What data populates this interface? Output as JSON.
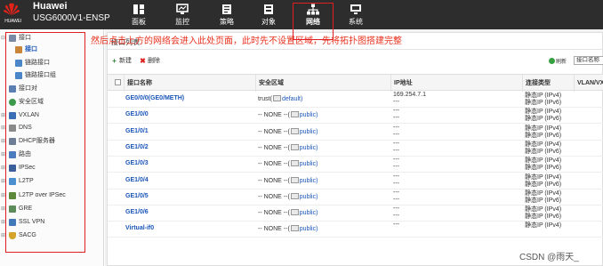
{
  "header": {
    "logo_text": "HUAWEI",
    "brand": "Huawei",
    "model": "USG6000V1-ENSP",
    "nav": [
      {
        "label": "面板",
        "icon": "dashboard-icon"
      },
      {
        "label": "监控",
        "icon": "monitor-icon"
      },
      {
        "label": "策略",
        "icon": "policy-icon"
      },
      {
        "label": "对象",
        "icon": "object-icon"
      },
      {
        "label": "网络",
        "icon": "network-icon",
        "active": true
      },
      {
        "label": "系统",
        "icon": "system-icon"
      }
    ]
  },
  "sidebar": {
    "items": [
      {
        "label": "接口",
        "icon": "interface-folder-icon",
        "expander": "⊟"
      },
      {
        "label": "接口",
        "icon": "interface-icon",
        "selected": true
      },
      {
        "label": "链路接口",
        "icon": "link-interface-icon"
      },
      {
        "label": "链路接口组",
        "icon": "link-interface-group-icon"
      },
      {
        "label": "接口对",
        "icon": "interface-pair-icon"
      },
      {
        "label": "安全区域",
        "icon": "security-zone-icon"
      },
      {
        "label": "VXLAN",
        "icon": "vxlan-icon",
        "expander": "⊞"
      },
      {
        "label": "DNS",
        "icon": "dns-icon",
        "expander": "⊞"
      },
      {
        "label": "DHCP服务器",
        "icon": "dhcp-server-icon",
        "expander": "⊞"
      },
      {
        "label": "路由",
        "icon": "route-icon",
        "expander": "⊞"
      },
      {
        "label": "IPSec",
        "icon": "ipsec-icon",
        "expander": "⊞"
      },
      {
        "label": "L2TP",
        "icon": "l2tp-icon",
        "expander": "⊞"
      },
      {
        "label": "L2TP over IPSec",
        "icon": "l2tp-over-ipsec-icon",
        "expander": "⊞"
      },
      {
        "label": "GRE",
        "icon": "gre-icon",
        "expander": "⊞"
      },
      {
        "label": "SSL VPN",
        "icon": "ssl-vpn-icon",
        "expander": "⊞"
      },
      {
        "label": "SACG",
        "icon": "sacg-icon",
        "expander": "⊞"
      }
    ]
  },
  "panel": {
    "title": "接口列表",
    "new_label": "新建",
    "delete_label": "删除",
    "refresh_label": "刷新",
    "search_placeholder": "接口名称"
  },
  "annotation": "然后点击上方的网络会进入此处页面，此时先不设置区域，先将拓扑图搭建完整",
  "table": {
    "headers": [
      "接口名称",
      "安全区域",
      "IP地址",
      "连接类型",
      "VLAN/VXLAN"
    ],
    "rows": [
      {
        "name": "GE0/0/0(GE0/METH)",
        "zone_prefix": "trust(",
        "zone_link": "default)",
        "ip1": "169.254.7.1",
        "ip2": "---",
        "conn1": "静态IP (IPv4)",
        "conn2": "静态IP (IPv6)"
      },
      {
        "name": "GE1/0/0",
        "zone_prefix": "-- NONE --(",
        "zone_link": "public)",
        "ip1": "---",
        "ip2": "---",
        "conn1": "静态IP (IPv4)",
        "conn2": "静态IP (IPv6)"
      },
      {
        "name": "GE1/0/1",
        "zone_prefix": "-- NONE --(",
        "zone_link": "public)",
        "ip1": "---",
        "ip2": "---",
        "conn1": "静态IP (IPv4)",
        "conn2": "静态IP (IPv6)"
      },
      {
        "name": "GE1/0/2",
        "zone_prefix": "-- NONE --(",
        "zone_link": "public)",
        "ip1": "---",
        "ip2": "---",
        "conn1": "静态IP (IPv4)",
        "conn2": "静态IP (IPv6)"
      },
      {
        "name": "GE1/0/3",
        "zone_prefix": "-- NONE --(",
        "zone_link": "public)",
        "ip1": "---",
        "ip2": "---",
        "conn1": "静态IP (IPv4)",
        "conn2": "静态IP (IPv6)"
      },
      {
        "name": "GE1/0/4",
        "zone_prefix": "-- NONE --(",
        "zone_link": "public)",
        "ip1": "---",
        "ip2": "---",
        "conn1": "静态IP (IPv4)",
        "conn2": "静态IP (IPv6)"
      },
      {
        "name": "GE1/0/5",
        "zone_prefix": "-- NONE --(",
        "zone_link": "public)",
        "ip1": "---",
        "ip2": "---",
        "conn1": "静态IP (IPv4)",
        "conn2": "静态IP (IPv6)"
      },
      {
        "name": "GE1/0/6",
        "zone_prefix": "-- NONE --(",
        "zone_link": "public)",
        "ip1": "---",
        "ip2": "---",
        "conn1": "静态IP (IPv4)",
        "conn2": "静态IP (IPv6)"
      },
      {
        "name": "Virtual-if0",
        "zone_prefix": "-- NONE --(",
        "zone_link": "public)",
        "ip1": "---",
        "ip2": "",
        "conn1": "静态IP (IPv4)",
        "conn2": ""
      }
    ]
  },
  "watermark": "CSDN @雨天_",
  "colors": {
    "annotation": "#e8301d",
    "highlight_box": "#e02020",
    "link": "#1a55b8",
    "topbar": "#2d2d2d"
  }
}
